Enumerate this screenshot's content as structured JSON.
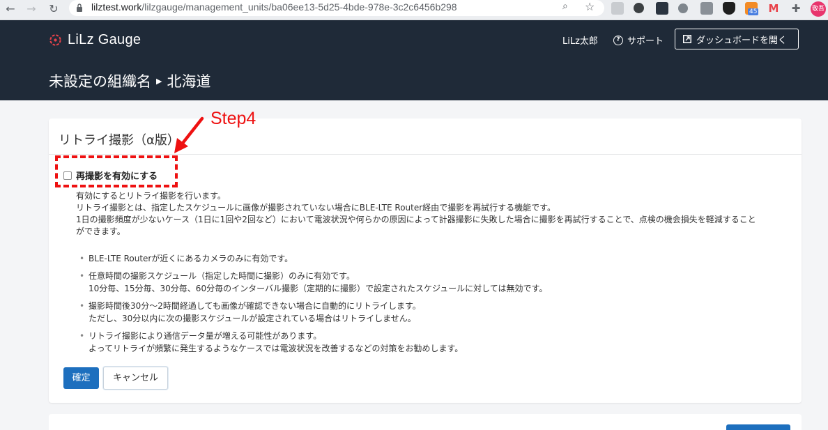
{
  "browser": {
    "url_host": "lilztest.work",
    "url_path": "/lilzgauge/management_units/ba06ee13-5d25-4bde-978e-3c2c6456b298",
    "extension_badge": "45",
    "profile_label": "敬吾"
  },
  "header": {
    "logo_text": "LiLz Gauge",
    "user_name": "LiLz太郎",
    "support_label": "サポート",
    "dashboard_button": "ダッシュボードを開く",
    "breadcrumb_org": "未設定の組織名",
    "breadcrumb_unit": "北海道"
  },
  "card": {
    "title": "リトライ撮影（α版）",
    "checkbox_label": "再撮影を有効にする",
    "checkbox_checked": false,
    "description_lines": [
      "有効にするとリトライ撮影を行います。",
      "リトライ撮影とは、指定したスケジュールに画像が撮影されていない場合にBLE-LTE Router経由で撮影を再試行する機能です。",
      "1日の撮影頻度が少ないケース（1日に1回や2回など）において電波状況や何らかの原因によって計器撮影に失敗した場合に撮影を再試行することで、点検の機会損失を軽減すること",
      "ができます。"
    ],
    "bullets": [
      {
        "line1": "BLE-LTE Routerが近くにあるカメラのみに有効です。",
        "line2": ""
      },
      {
        "line1": "任意時間の撮影スケジュール（指定した時間に撮影）のみに有効です。",
        "line2": "10分毎、15分毎、30分毎、60分毎のインターバル撮影（定期的に撮影）で設定されたスケジュールに対しては無効です。"
      },
      {
        "line1": "撮影時間後30分〜2時間経過しても画像が確認できない場合に自動的にリトライします。",
        "line2": "ただし、30分以内に次の撮影スケジュールが設定されている場合はリトライしません。"
      },
      {
        "line1": "リトライ撮影により通信データ量が増える可能性があります。",
        "line2": "よってリトライが頻繁に発生するようなケースでは電波状況を改善するなどの対策をお勧めします。"
      }
    ],
    "confirm_button": "確定",
    "cancel_button": "キャンセル"
  },
  "annotation": {
    "step_label": "Step4",
    "color": "#ee1111"
  },
  "colors": {
    "header_bg": "#1f2a38",
    "primary": "#1d6fbe",
    "page_bg": "#f4f5f7",
    "logo_accent": "#e8424a"
  },
  "icons": [
    "back-arrow-icon",
    "forward-arrow-icon",
    "reload-icon",
    "lock-icon",
    "zoom-icon",
    "star-icon",
    "question-icon",
    "external-link-icon",
    "lilz-logo-icon"
  ]
}
